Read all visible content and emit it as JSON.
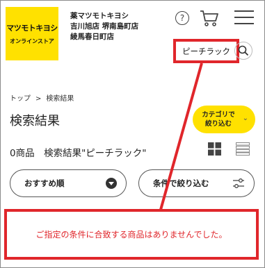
{
  "header": {
    "logo_main": "マツモトキヨシ",
    "logo_sub": "オンラインストア",
    "store_lines": [
      "薬マツモトキヨシ",
      "吉川旭店 堺南島町店",
      "綾馬春日町店"
    ]
  },
  "search": {
    "value": "ピーチラック"
  },
  "breadcrumb": {
    "home": "トップ",
    "separator": ">",
    "current": "検索結果"
  },
  "page_title": "検索結果",
  "category_button": {
    "line1": "カテゴリで",
    "line2": "絞り込む"
  },
  "results": {
    "count_text": "0商品　検索結果\"ピーチラック\""
  },
  "sort": {
    "label": "おすすめ順"
  },
  "filter": {
    "label": "条件で絞り込む"
  },
  "message": {
    "no_results": "ご指定の条件に合致する商品はありませんでした。"
  },
  "colors": {
    "brand_yellow": "#ffe100",
    "highlight_red": "#e0262b"
  },
  "icons": [
    "help-icon",
    "cart-icon",
    "menu-icon",
    "search-icon",
    "grid-view-icon",
    "list-view-icon",
    "chevron-down-icon",
    "filter-icon"
  ]
}
